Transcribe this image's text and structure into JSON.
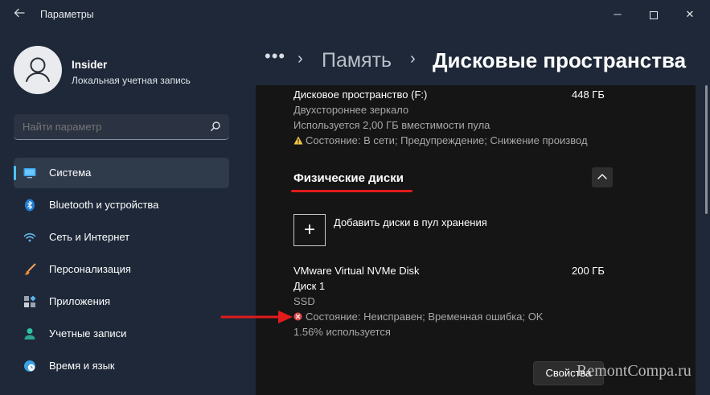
{
  "window": {
    "title": "Параметры",
    "controls": {
      "minimize": "─",
      "close": "✕"
    }
  },
  "sidebar": {
    "profile": {
      "name": "Insider",
      "subtitle": "Локальная учетная запись"
    },
    "search": {
      "placeholder": "Найти параметр"
    },
    "items": [
      {
        "label": "Система",
        "icon": "monitor-icon",
        "active": true
      },
      {
        "label": "Bluetooth и устройства",
        "icon": "bluetooth-icon"
      },
      {
        "label": "Сеть и Интернет",
        "icon": "wifi-icon"
      },
      {
        "label": "Персонализация",
        "icon": "brush-icon"
      },
      {
        "label": "Приложения",
        "icon": "apps-icon"
      },
      {
        "label": "Учетные записи",
        "icon": "person-icon"
      },
      {
        "label": "Время и язык",
        "icon": "clock-globe-icon"
      }
    ]
  },
  "header": {
    "breadcrumb_more": "•••",
    "breadcrumb_separator": "›",
    "breadcrumb_parent": "Память",
    "page_title": "Дисковые пространства"
  },
  "storage_space": {
    "name": "Дисковое пространство (F:)",
    "size": "448 ГБ",
    "type": "Двухстороннее зеркало",
    "usage": "Используется 2,00 ГБ вместимости пула",
    "status": "Состояние: В сети; Предупреждение; Снижение производ"
  },
  "physical_disks": {
    "section_title": "Физические диски",
    "add_icon_glyph": "+",
    "add_label": "Добавить диски в пул хранения",
    "disk": {
      "name": "VMware Virtual NVMe Disk",
      "size": "200 ГБ",
      "index": "Диск 1",
      "media": "SSD",
      "status": "Состояние: Неисправен; Временная ошибка; OK",
      "usage": "1.56% используется"
    },
    "properties_button": "Свойства"
  },
  "watermark": "RemontCompa.ru",
  "colors": {
    "accent": "#4cc2ff",
    "annotation_red": "#e21b1b",
    "warning_yellow": "#f2c744",
    "error_red": "#e24d4d"
  }
}
